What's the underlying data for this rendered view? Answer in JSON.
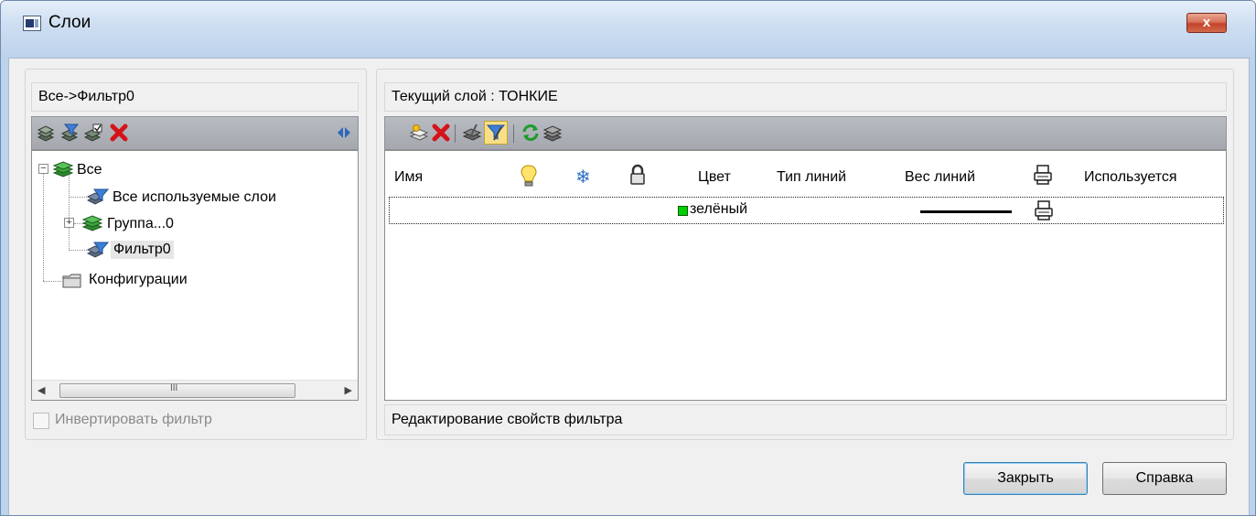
{
  "window": {
    "title": "Слои",
    "close_label": "x"
  },
  "left_panel": {
    "filter_path": "Все->Фильтр0",
    "tree": [
      {
        "label": "Все"
      },
      {
        "label": "Все используемые слои"
      },
      {
        "label": "Группа...0"
      },
      {
        "label": "Фильтр0"
      },
      {
        "label": "Конфигурации"
      }
    ],
    "scroll_grip": "III",
    "invert_filter_label": "Инвертировать фильтр",
    "invert_filter_checked": false
  },
  "right_panel": {
    "current_layer": "Текущий слой : ТОНКИЕ",
    "columns": [
      "Имя",
      "",
      "",
      "",
      "Цвет",
      "Тип линий",
      "Вес линий",
      "",
      "Используется"
    ],
    "rows": [
      {
        "name": "",
        "color_name": "зелёный",
        "color_hex": "#00d000"
      }
    ],
    "status_text": "Редактирование свойств фильтра"
  },
  "buttons": {
    "close": "Закрыть",
    "help": "Справка"
  },
  "colors": {
    "accent": "#3c7fb1",
    "title_bg": "#bcd3ec",
    "green": "#00d000"
  }
}
